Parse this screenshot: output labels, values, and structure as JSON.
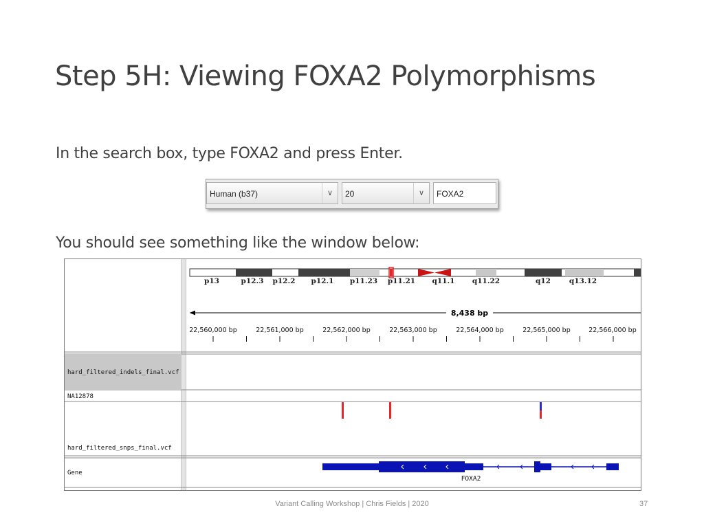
{
  "slide": {
    "title": "Step 5H: Viewing FOXA2 Polymorphisms",
    "instruction1_prefix": "In the search box, type ",
    "instruction1_term": "FOXA2",
    "instruction1_middle": " and press ",
    "instruction1_key": "Enter.",
    "instruction2": "You should see something like the window below:",
    "footer": "Variant Calling Workshop | Chris Fields | 2020",
    "page_number": "37"
  },
  "toolbar": {
    "genome_value": "Human (b37)",
    "chromosome_value": "20",
    "search_value": "FOXA2",
    "dropdown_icon": "chevron-down-icon"
  },
  "igv": {
    "cytobands": [
      "p13",
      "p12.3",
      "p12.2",
      "p12.1",
      "p11.23",
      "p11.21",
      "q11.1",
      "q11.22",
      "q12",
      "q13.12"
    ],
    "span_label": "8,438 bp",
    "ruler_ticks": [
      "22,560,000 bp",
      "22,561,000 bp",
      "22,562,000 bp",
      "22,563,000 bp",
      "22,564,000 bp",
      "22,565,000 bp",
      "22,566,000 bp"
    ],
    "track_indels": "hard_filtered_indels_final.vcf",
    "track_sample": "NA12878",
    "track_snps": "hard_filtered_snps_final.vcf",
    "track_gene": "Gene",
    "gene_label": "FOXA2",
    "colors": {
      "variant": "#e8262a",
      "variant_het": "#2a2ad8",
      "gene": "#0a14b4",
      "centromere": "#c81414",
      "selected_track": "#c8c8c8"
    }
  }
}
